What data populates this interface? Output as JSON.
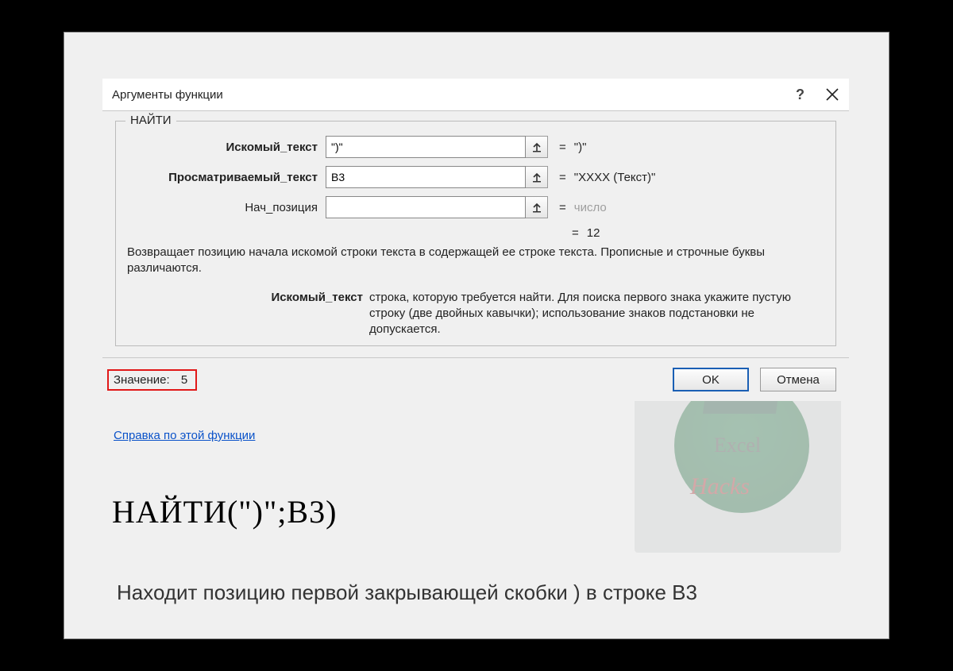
{
  "dialog": {
    "title": "Аргументы функции",
    "function_name": "НАЙТИ",
    "arguments": [
      {
        "label": "Искомый_текст",
        "bold": true,
        "value": "\")\"",
        "result": "\")\""
      },
      {
        "label": "Просматриваемый_текст",
        "bold": true,
        "value": "B3",
        "result": "\"XXXX (Текст)\""
      },
      {
        "label": "Нач_позиция",
        "bold": false,
        "value": "",
        "result": "число",
        "muted": true
      }
    ],
    "overall_result": "12",
    "description": "Возвращает позицию начала искомой строки текста в содержащей ее строке текста. Прописные и строчные буквы различаются.",
    "param_name": "Искомый_текст",
    "param_hint": "строка, которую требуется найти. Для поиска первого знака укажите пустую строку (две двойных кавычки); использование знаков подстановки не допускается.",
    "result_label": "Значение:",
    "result_value": "5",
    "help_link": "Справка по этой функции",
    "buttons": {
      "ok": "OK",
      "cancel": "Отмена"
    }
  },
  "watermark": {
    "line1": "Excel",
    "line2": "Hacks"
  },
  "formula": "НАЙТИ(\")\";B3)",
  "caption": "Находит позицию первой закрывающей скобки ) в строке B3"
}
